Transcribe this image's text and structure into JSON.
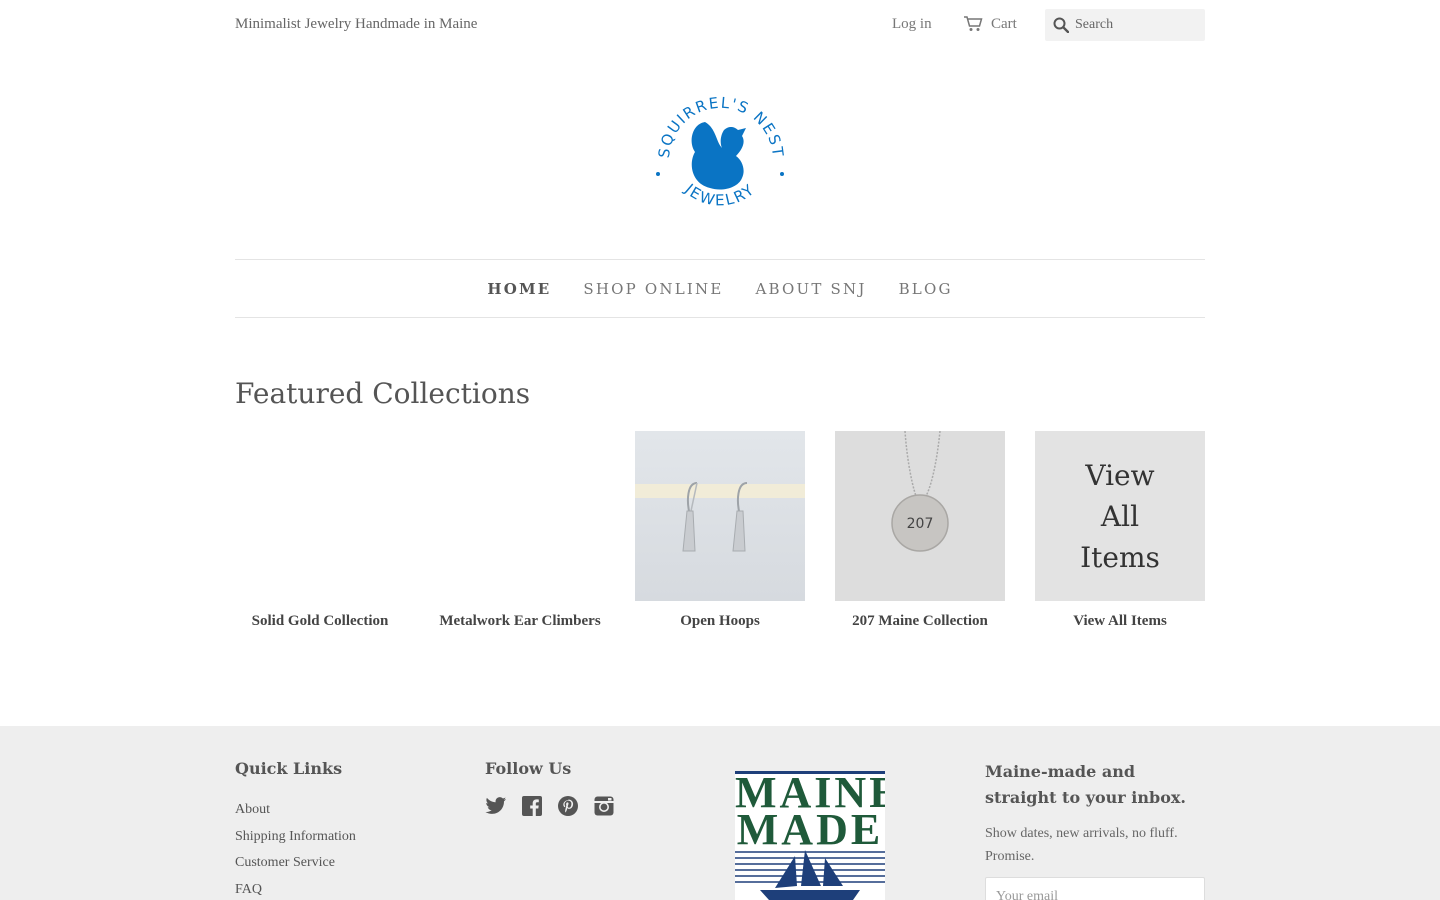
{
  "header": {
    "tagline": "Minimalist Jewelry Handmade in Maine",
    "login_label": "Log in",
    "cart_label": "Cart",
    "search_placeholder": "Search"
  },
  "logo": {
    "ring_text_top": "SQUIRREL'S NEST",
    "ring_text_bottom": "JEWELRY",
    "brand_color": "#0a74c4"
  },
  "nav": {
    "items": [
      {
        "label": "HOME",
        "active": true
      },
      {
        "label": "SHOP ONLINE",
        "active": false
      },
      {
        "label": "ABOUT SNJ",
        "active": false
      },
      {
        "label": "BLOG",
        "active": false
      }
    ]
  },
  "featured": {
    "title": "Featured Collections",
    "collections": [
      {
        "label": "Solid Gold Collection",
        "image": "none"
      },
      {
        "label": "Metalwork Ear Climbers",
        "image": "none"
      },
      {
        "label": "Open Hoops",
        "image": "silver-hoop-earrings-photo"
      },
      {
        "label": "207 Maine Collection",
        "image": "207-pendant-necklace-photo",
        "pendant_text": "207"
      },
      {
        "label": "View All Items",
        "image": "view-all-tile",
        "tile_lines": [
          "View",
          "All",
          "Items"
        ]
      }
    ]
  },
  "footer": {
    "quick_links_title": "Quick Links",
    "quick_links": [
      "About",
      "Shipping Information",
      "Customer Service",
      "FAQ"
    ],
    "follow_title": "Follow Us",
    "social_icons": [
      "twitter-icon",
      "facebook-icon",
      "pinterest-icon",
      "instagram-icon"
    ],
    "badge_text": [
      "MAINE",
      "MADE"
    ],
    "newsletter_title": "Maine-made and straight to your inbox.",
    "newsletter_text": "Show dates, new arrivals, no fluff. Promise.",
    "email_placeholder": "Your email"
  }
}
